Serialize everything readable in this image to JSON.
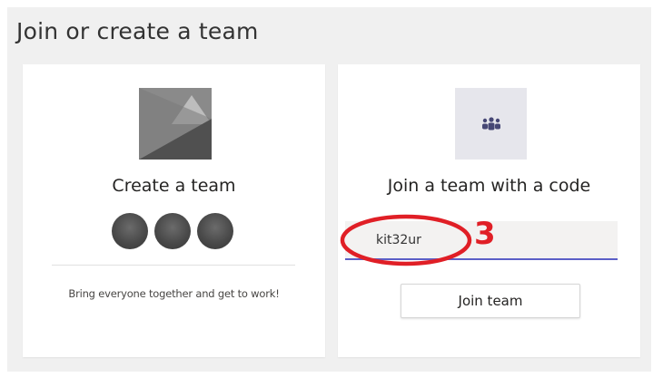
{
  "page": {
    "title": "Join or create a team"
  },
  "create_card": {
    "title": "Create a team",
    "description": "Bring everyone together and get to work!",
    "image_icon": "team-image-placeholder",
    "avatars": [
      "avatar",
      "avatar",
      "avatar"
    ]
  },
  "join_card": {
    "title": "Join a team with a code",
    "icon": "people-group-icon",
    "code_input": {
      "value": "kit32ur"
    },
    "button_label": "Join team"
  },
  "annotation": {
    "number": "3",
    "color": "#e01f26"
  },
  "colors": {
    "accent_underline": "#5b5fc7",
    "panel_bg": "#f0f0f0"
  }
}
